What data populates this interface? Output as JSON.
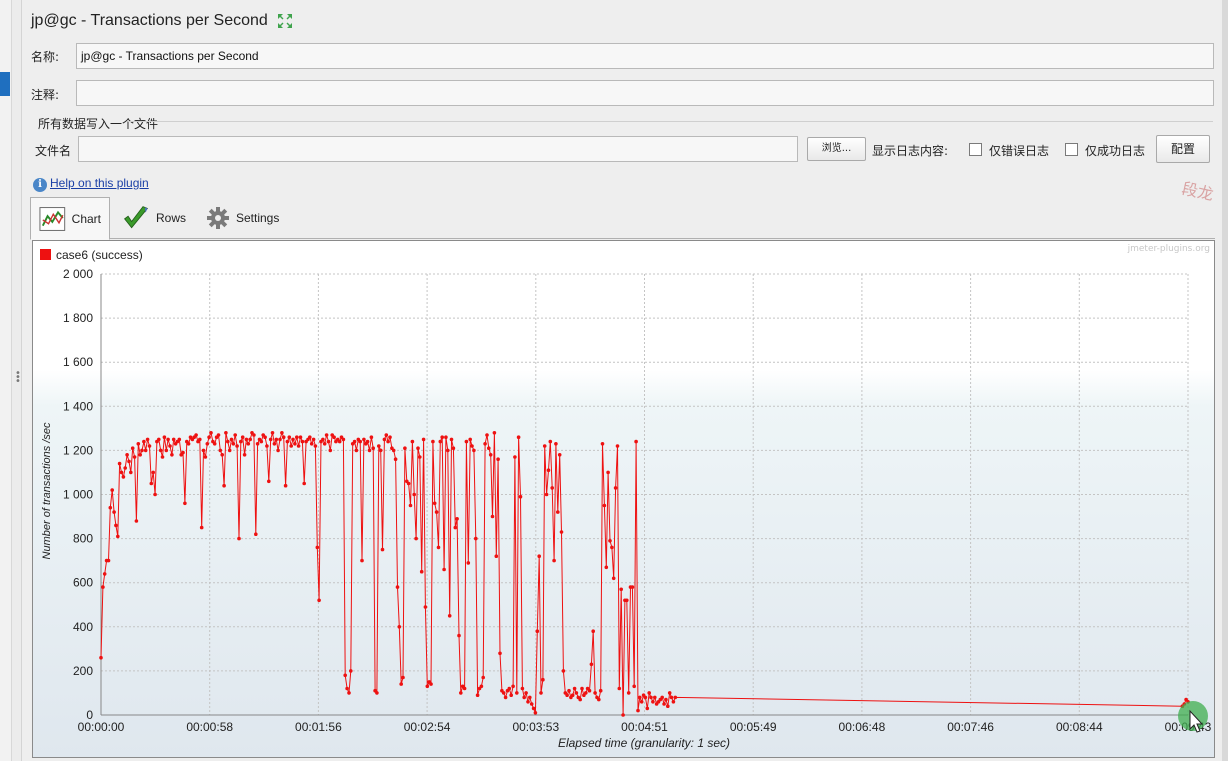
{
  "window": {
    "title": "jp@gc - Transactions per Second"
  },
  "form": {
    "name_label": "名称:",
    "name_value": "jp@gc - Transactions per Second",
    "comment_label": "注释:",
    "comment_value": "",
    "group_title": "所有数据写入一个文件",
    "file_label": "文件名",
    "file_value": "",
    "browse_label": "浏览...",
    "log_label": "显示日志内容:",
    "errors_only_label": "仅错误日志",
    "success_only_label": "仅成功日志",
    "configure_label": "配置"
  },
  "help": {
    "link_text": "Help on this plugin"
  },
  "watermark": {
    "text": "段龙"
  },
  "tabs": [
    {
      "label": "Chart",
      "icon": "chart-icon",
      "active": true
    },
    {
      "label": "Rows",
      "icon": "checkmark-icon",
      "active": false
    },
    {
      "label": "Settings",
      "icon": "gear-icon",
      "active": false
    }
  ],
  "chart_data": {
    "type": "line",
    "credit": "jmeter-plugins.org",
    "xlabel": "Elapsed time (granularity: 1 sec)",
    "ylabel": "Number of transactions /sec",
    "x_tick_labels": [
      "00:00:00",
      "00:00:58",
      "00:01:56",
      "00:02:54",
      "00:03:53",
      "00:04:51",
      "00:05:49",
      "00:06:48",
      "00:07:46",
      "00:08:44",
      "00:09:43"
    ],
    "y_tick_labels": [
      "0",
      "200",
      "400",
      "600",
      "800",
      "1 000",
      "1 200",
      "1 400",
      "1 600",
      "1 800",
      "2 000"
    ],
    "xlim_seconds": [
      0,
      583
    ],
    "ylim": [
      0,
      2000
    ],
    "grid": true,
    "legend_position": "top-left",
    "series": [
      {
        "name": "case6 (success)",
        "color": "#ee1111",
        "x_seconds": [
          0,
          1,
          2,
          3,
          4,
          5,
          6,
          7,
          8,
          9,
          10,
          11,
          12,
          13,
          14,
          15,
          16,
          17,
          18,
          19,
          20,
          21,
          22,
          23,
          24,
          25,
          26,
          27,
          28,
          29,
          30,
          31,
          32,
          33,
          34,
          35,
          36,
          37,
          38,
          39,
          40,
          41,
          42,
          43,
          44,
          45,
          46,
          47,
          48,
          49,
          50,
          51,
          52,
          53,
          54,
          55,
          56,
          57,
          58,
          59,
          60,
          61,
          62,
          63,
          64,
          65,
          66,
          67,
          68,
          69,
          70,
          71,
          72,
          73,
          74,
          75,
          76,
          77,
          78,
          79,
          80,
          81,
          82,
          83,
          84,
          85,
          86,
          87,
          88,
          89,
          90,
          91,
          92,
          93,
          94,
          95,
          96,
          97,
          98,
          99,
          100,
          101,
          102,
          103,
          104,
          105,
          106,
          107,
          108,
          109,
          110,
          111,
          112,
          113,
          114,
          115,
          116,
          117,
          118,
          119,
          120,
          121,
          122,
          123,
          124,
          125,
          126,
          127,
          128,
          129,
          130,
          131,
          132,
          133,
          134,
          135,
          136,
          137,
          138,
          139,
          140,
          141,
          142,
          143,
          144,
          145,
          146,
          147,
          148,
          149,
          150,
          151,
          152,
          153,
          154,
          155,
          156,
          157,
          158,
          159,
          160,
          161,
          162,
          163,
          164,
          165,
          166,
          167,
          168,
          169,
          170,
          171,
          172,
          173,
          174,
          175,
          176,
          177,
          178,
          179,
          180,
          181,
          182,
          183,
          184,
          185,
          186,
          187,
          188,
          189,
          190,
          191,
          192,
          193,
          194,
          195,
          196,
          197,
          198,
          199,
          200,
          201,
          202,
          203,
          204,
          205,
          206,
          207,
          208,
          209,
          210,
          211,
          212,
          213,
          214,
          215,
          216,
          217,
          218,
          219,
          220,
          221,
          222,
          223,
          224,
          225,
          226,
          227,
          228,
          229,
          230,
          231,
          232,
          233,
          234,
          235,
          236,
          237,
          238,
          239,
          240,
          241,
          242,
          243,
          244,
          245,
          246,
          247,
          248,
          249,
          250,
          251,
          252,
          253,
          254,
          255,
          256,
          257,
          258,
          259,
          260,
          261,
          262,
          263,
          264,
          265,
          266,
          267,
          268,
          269,
          270,
          271,
          272,
          273,
          274,
          275,
          276,
          277,
          278,
          279,
          280,
          281,
          282,
          283,
          284,
          285,
          286,
          287,
          288,
          289,
          290,
          291,
          292,
          293,
          294,
          295,
          296,
          297,
          298,
          299,
          300,
          301,
          302,
          303,
          304,
          305,
          306,
          307,
          308,
          580,
          581,
          582,
          583
        ],
        "values": [
          260,
          580,
          640,
          700,
          700,
          940,
          1020,
          920,
          860,
          810,
          1140,
          1100,
          1080,
          1120,
          1180,
          1150,
          1100,
          1210,
          1170,
          880,
          1230,
          1180,
          1200,
          1240,
          1200,
          1250,
          1220,
          1050,
          1100,
          1000,
          1240,
          1250,
          1200,
          1170,
          1260,
          1200,
          1250,
          1220,
          1180,
          1250,
          1230,
          1240,
          1250,
          1180,
          1190,
          960,
          1240,
          1230,
          1260,
          1250,
          1260,
          1270,
          1240,
          1250,
          850,
          1200,
          1170,
          1230,
          1260,
          1280,
          1240,
          1230,
          1260,
          1270,
          1200,
          1180,
          1040,
          1280,
          1240,
          1200,
          1250,
          1230,
          1270,
          1220,
          800,
          1240,
          1260,
          1180,
          1250,
          1230,
          1250,
          1280,
          1270,
          820,
          1230,
          1250,
          1240,
          1270,
          1260,
          1220,
          1060,
          1250,
          1280,
          1230,
          1250,
          1200,
          1250,
          1280,
          1260,
          1040,
          1240,
          1260,
          1220,
          1250,
          1230,
          1260,
          1220,
          1260,
          1240,
          1050,
          1240,
          1250,
          1260,
          1230,
          1250,
          1220,
          760,
          520,
          1240,
          1250,
          1230,
          1270,
          1240,
          1200,
          1270,
          1260,
          1240,
          1250,
          1240,
          1260,
          1250,
          180,
          120,
          100,
          200,
          1230,
          1240,
          1200,
          1250,
          1240,
          700,
          1250,
          1230,
          1240,
          1200,
          1260,
          1210,
          110,
          100,
          1220,
          1200,
          750,
          1250,
          1270,
          1240,
          1260,
          1210,
          1200,
          1160,
          580,
          400,
          140,
          170,
          1210,
          1060,
          1050,
          950,
          1240,
          1000,
          800,
          1210,
          1170,
          650,
          1250,
          490,
          130,
          150,
          140,
          1240,
          960,
          920,
          760,
          1240,
          1260,
          660,
          1260,
          1200,
          450,
          1250,
          1210,
          850,
          890,
          360,
          100,
          130,
          120,
          1240,
          690,
          1250,
          1220,
          1200,
          800,
          90,
          120,
          130,
          170,
          1230,
          1270,
          1210,
          1180,
          900,
          1280,
          720,
          1160,
          280,
          110,
          100,
          80,
          110,
          120,
          90,
          130,
          1170,
          100,
          1260,
          990,
          120,
          80,
          100,
          60,
          80,
          50,
          30,
          10,
          380,
          720,
          100,
          160,
          1220,
          1000,
          1110,
          1240,
          1030,
          700,
          1230,
          920,
          1180,
          830,
          200,
          100,
          90,
          110,
          80,
          90,
          120,
          100,
          80,
          70,
          120,
          90,
          100,
          120,
          110,
          230,
          380,
          100,
          80,
          70,
          110,
          1230,
          950,
          670,
          1100,
          790,
          760,
          620,
          1030,
          1220,
          120,
          570,
          0,
          520,
          520,
          100,
          580,
          580,
          130,
          1240,
          20,
          80,
          60,
          90,
          80,
          30,
          100,
          80,
          60,
          80,
          50,
          60,
          70,
          80,
          50,
          70,
          40,
          100,
          80,
          60,
          80,
          40,
          50,
          70,
          60,
          80,
          100,
          60,
          20,
          70,
          80,
          60,
          50,
          90,
          1100,
          650,
          660,
          1100,
          780,
          860,
          640,
          560,
          540,
          400,
          20,
          50,
          30,
          60,
          40,
          50,
          20,
          30,
          50,
          30,
          60,
          50,
          10,
          40,
          60,
          50
        ]
      }
    ]
  }
}
